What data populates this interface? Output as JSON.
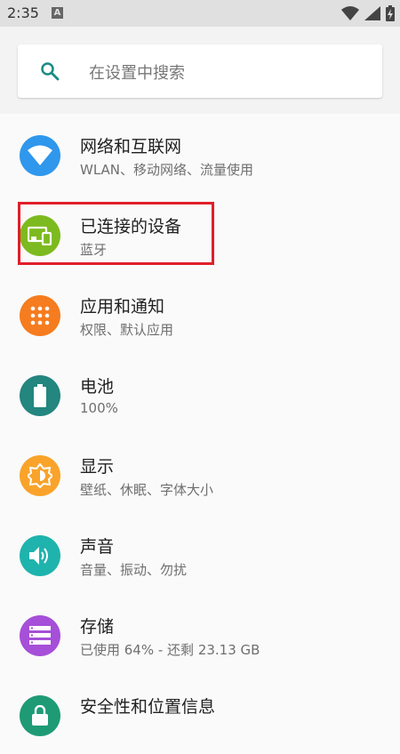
{
  "status_bar": {
    "time": "2:35",
    "notif_letter": "A"
  },
  "search": {
    "placeholder": "在设置中搜索"
  },
  "items": [
    {
      "title": "网络和互联网",
      "subtitle": "WLAN、移动网络、流量使用",
      "icon": "wifi-icon",
      "color": "#2f97ec"
    },
    {
      "title": "已连接的设备",
      "subtitle": "蓝牙",
      "icon": "devices-icon",
      "color": "#7dba1f"
    },
    {
      "title": "应用和通知",
      "subtitle": "权限、默认应用",
      "icon": "apps-grid-icon",
      "color": "#f57c1f"
    },
    {
      "title": "电池",
      "subtitle": "100%",
      "icon": "battery-icon",
      "color": "#23867f"
    },
    {
      "title": "显示",
      "subtitle": "壁纸、休眠、字体大小",
      "icon": "brightness-icon",
      "color": "#f9a32b"
    },
    {
      "title": "声音",
      "subtitle": "音量、振动、勿扰",
      "icon": "volume-icon",
      "color": "#1fb3ad"
    },
    {
      "title": "存储",
      "subtitle": "已使用 64% - 还剩 23.13 GB",
      "icon": "storage-icon",
      "color": "#a64fd8"
    },
    {
      "title": "安全性和位置信息",
      "subtitle": "",
      "icon": "lock-icon",
      "color": "#1e9b74"
    }
  ]
}
